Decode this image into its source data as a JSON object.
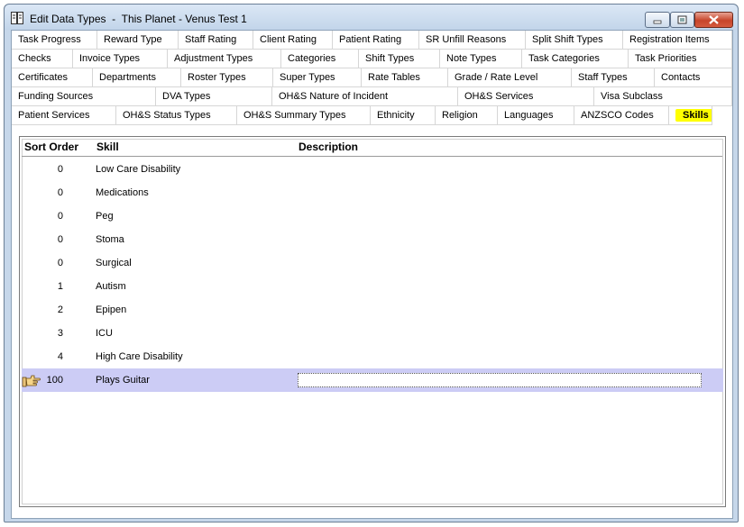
{
  "window": {
    "title": "Edit Data Types  -  This Planet - Venus Test 1"
  },
  "tab_rows": [
    [
      {
        "label": "Task Progress",
        "w": 95
      },
      {
        "label": "Reward Type",
        "w": 90
      },
      {
        "label": "Staff Rating",
        "w": 83
      },
      {
        "label": "Client Rating",
        "w": 88
      },
      {
        "label": "Patient Rating",
        "w": 96
      },
      {
        "label": "SR Unfill Reasons",
        "w": 118
      },
      {
        "label": "Split Shift Types",
        "w": 108
      },
      {
        "label": "Registration Items",
        "w": 121
      }
    ],
    [
      {
        "label": "Checks",
        "w": 68
      },
      {
        "label": "Invoice Types",
        "w": 105
      },
      {
        "label": "Adjustment Types",
        "w": 126
      },
      {
        "label": "Categories",
        "w": 86
      },
      {
        "label": "Shift Types",
        "w": 90
      },
      {
        "label": "Note Types",
        "w": 91
      },
      {
        "label": "Task Categories",
        "w": 118
      },
      {
        "label": "Task Priorities",
        "w": 115
      }
    ],
    [
      {
        "label": "Certificates",
        "w": 90
      },
      {
        "label": "Departments",
        "w": 98
      },
      {
        "label": "Roster Types",
        "w": 102
      },
      {
        "label": "Super Types",
        "w": 98
      },
      {
        "label": "Rate Tables",
        "w": 96
      },
      {
        "label": "Grade / Rate Level",
        "w": 137
      },
      {
        "label": "Staff Types",
        "w": 92
      },
      {
        "label": "Contacts",
        "w": 86
      }
    ],
    [
      {
        "label": "Funding Sources",
        "w": 160
      },
      {
        "label": "DVA Types",
        "w": 129
      },
      {
        "label": "OH&S Nature of Incident",
        "w": 206
      },
      {
        "label": "OH&S Services",
        "w": 151
      },
      {
        "label": "Visa Subclass",
        "w": 153
      }
    ],
    [
      {
        "label": "Patient Services",
        "w": 116
      },
      {
        "label": "OH&S Status Types",
        "w": 134
      },
      {
        "label": "OH&S Summary Types",
        "w": 148
      },
      {
        "label": "Ethnicity",
        "w": 72
      },
      {
        "label": "Religion",
        "w": 69
      },
      {
        "label": "Languages",
        "w": 85
      },
      {
        "label": "ANZSCO Codes",
        "w": 105
      },
      {
        "label": "Skills",
        "w": 48,
        "active": true
      }
    ]
  ],
  "grid": {
    "columns": [
      "Sort Order",
      "Skill",
      "Description"
    ],
    "rows": [
      {
        "sort": "0",
        "skill": "Low Care Disability",
        "description": ""
      },
      {
        "sort": "0",
        "skill": "Medications",
        "description": ""
      },
      {
        "sort": "0",
        "skill": "Peg",
        "description": ""
      },
      {
        "sort": "0",
        "skill": "Stoma",
        "description": ""
      },
      {
        "sort": "0",
        "skill": "Surgical",
        "description": ""
      },
      {
        "sort": "1",
        "skill": "Autism",
        "description": ""
      },
      {
        "sort": "2",
        "skill": "Epipen",
        "description": ""
      },
      {
        "sort": "3",
        "skill": "ICU",
        "description": ""
      },
      {
        "sort": "4",
        "skill": "High Care Disability",
        "description": ""
      },
      {
        "sort": "100",
        "skill": "Plays Guitar",
        "description": "",
        "selected": true
      }
    ]
  },
  "icons": {
    "app": "data-types-icon",
    "row_pointer": "pointing-hand-icon"
  },
  "colors": {
    "active_tab_highlight": "#ffff00",
    "selected_row": "#ccccf5",
    "title_bar": "#c6d7ea",
    "close_button": "#c7452a"
  }
}
